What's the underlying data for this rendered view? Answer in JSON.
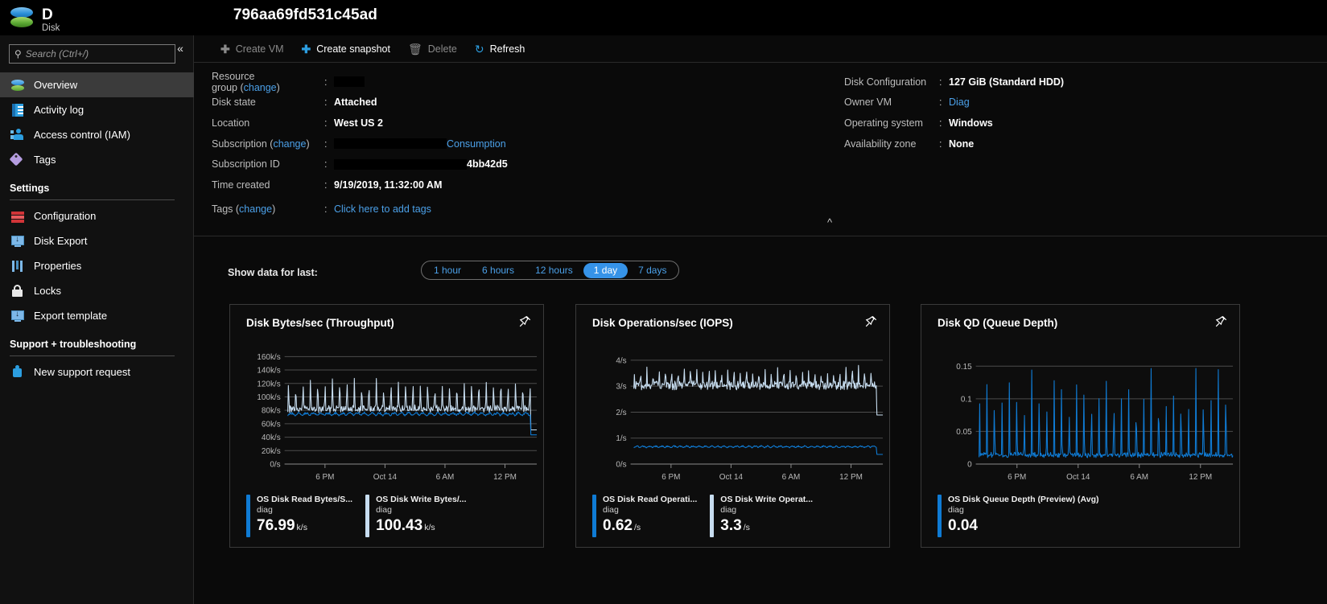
{
  "titlebar": {
    "resource_name": "D",
    "resource_id_suffix": "796aa69fd531c45ad",
    "resource_type": "Disk",
    "icon": "disk-icon"
  },
  "sidebar": {
    "search": {
      "placeholder": "Search (Ctrl+/)",
      "value": "",
      "icon": "search-icon"
    },
    "collapse_icon": "«",
    "items": [
      {
        "label": "Overview",
        "icon": "disk-icon",
        "active": true
      },
      {
        "label": "Activity log",
        "icon": "activity-log-icon",
        "active": false
      },
      {
        "label": "Access control (IAM)",
        "icon": "access-control-icon",
        "active": false
      },
      {
        "label": "Tags",
        "icon": "tag-icon",
        "active": false
      }
    ],
    "settings_header": "Settings",
    "settings_items": [
      {
        "label": "Configuration",
        "icon": "configuration-icon"
      },
      {
        "label": "Disk Export",
        "icon": "disk-export-icon"
      },
      {
        "label": "Properties",
        "icon": "properties-icon"
      },
      {
        "label": "Locks",
        "icon": "lock-icon"
      },
      {
        "label": "Export template",
        "icon": "export-template-icon"
      }
    ],
    "support_header": "Support + troubleshooting",
    "support_items": [
      {
        "label": "New support request",
        "icon": "support-request-icon"
      }
    ]
  },
  "commandbar": {
    "buttons": [
      {
        "label": "Create VM",
        "icon": "plus-icon",
        "enabled": false
      },
      {
        "label": "Create snapshot",
        "icon": "plus-icon",
        "enabled": true
      },
      {
        "label": "Delete",
        "icon": "trash-icon",
        "enabled": false
      },
      {
        "label": "Refresh",
        "icon": "refresh-icon",
        "enabled": true
      }
    ]
  },
  "properties": {
    "left": [
      {
        "label": "Resource group",
        "change_link": "change",
        "value": "",
        "redacted": true,
        "redact_width": 38
      },
      {
        "label": "Disk state",
        "value": "Attached"
      },
      {
        "label": "Location",
        "value": "West US 2"
      },
      {
        "label": "Subscription",
        "change_link": "change",
        "value": "Consumption",
        "redacted": true,
        "redact_width": 140,
        "value_is_link": true
      },
      {
        "label": "Subscription ID",
        "value": "4bb42d5",
        "redacted": true,
        "redact_width": 165
      },
      {
        "label": "Time created",
        "value": "9/19/2019, 11:32:00 AM"
      },
      {
        "label": "Tags",
        "change_link": "change",
        "value": "Click here to add tags",
        "value_is_link": true
      }
    ],
    "right": [
      {
        "label": "Disk Configuration",
        "value": "127 GiB (Standard HDD)"
      },
      {
        "label": "Owner VM",
        "value": "Diag",
        "value_is_link": true
      },
      {
        "label": "Operating system",
        "value": "Windows"
      },
      {
        "label": "Availability zone",
        "value": "None"
      }
    ],
    "collapse_icon": "chevron-up-icon"
  },
  "timerange": {
    "label": "Show data for last:",
    "options": [
      "1 hour",
      "6 hours",
      "12 hours",
      "1 day",
      "7 days"
    ],
    "selected": "1 day"
  },
  "colors": {
    "read_series": "#0f7bd4",
    "write_series": "#c7ddf0",
    "accent": "#3693e8",
    "link": "#4ba0e8"
  },
  "chart_data": [
    {
      "type": "line",
      "title": "Disk Bytes/sec (Throughput)",
      "pin_icon": "pin-icon",
      "xlabel": "",
      "ylabel": "",
      "ytick_labels": [
        "160k/s",
        "140k/s",
        "120k/s",
        "100k/s",
        "80k/s",
        "60k/s",
        "40k/s",
        "20k/s",
        "0/s"
      ],
      "ytick_values": [
        160000,
        140000,
        120000,
        100000,
        80000,
        60000,
        40000,
        20000,
        0
      ],
      "ylim": [
        0,
        170000
      ],
      "xtick_labels": [
        "6 PM",
        "Oct 14",
        "6 AM",
        "12 PM"
      ],
      "grid": true,
      "legend_position": "bottom",
      "series": [
        {
          "name": "OS Disk Read Bytes/S...",
          "resource": "diag",
          "value": "76.99",
          "unit": "k/s",
          "color": "#0f7bd4",
          "baseline": 70000,
          "peak": 80000,
          "spike_count": 34,
          "style": "low-ripple"
        },
        {
          "name": "OS Disk Write Bytes/...",
          "resource": "diag",
          "value": "100.43",
          "unit": "k/s",
          "color": "#c7ddf0",
          "baseline": 82000,
          "peak": 124000,
          "spike_count": 34,
          "style": "sawtooth"
        }
      ]
    },
    {
      "type": "line",
      "title": "Disk Operations/sec (IOPS)",
      "pin_icon": "pin-icon",
      "xlabel": "",
      "ylabel": "",
      "ytick_labels": [
        "4/s",
        "3/s",
        "2/s",
        "1/s",
        "0/s"
      ],
      "ytick_values": [
        4,
        3,
        2,
        1,
        0
      ],
      "ylim": [
        0,
        4.4
      ],
      "xtick_labels": [
        "6 PM",
        "Oct 14",
        "6 AM",
        "12 PM"
      ],
      "grid": true,
      "legend_position": "bottom",
      "series": [
        {
          "name": "OS Disk Read Operati...",
          "resource": "diag",
          "value": "0.62",
          "unit": "/s",
          "color": "#0f7bd4",
          "baseline": 0.6,
          "peak": 0.75,
          "spike_count": 40,
          "style": "low-ripple"
        },
        {
          "name": "OS Disk Write Operat...",
          "resource": "diag",
          "value": "3.3",
          "unit": "/s",
          "color": "#c7ddf0",
          "baseline": 3.05,
          "peak": 3.7,
          "spike_count": 40,
          "style": "sawtooth"
        }
      ]
    },
    {
      "type": "line",
      "title": "Disk QD (Queue Depth)",
      "pin_icon": "pin-icon",
      "xlabel": "",
      "ylabel": "",
      "ytick_labels": [
        "0.15",
        "0.1",
        "0.05",
        "0"
      ],
      "ytick_values": [
        0.15,
        0.1,
        0.05,
        0
      ],
      "ylim": [
        0,
        0.175
      ],
      "xtick_labels": [
        "6 PM",
        "Oct 14",
        "6 AM",
        "12 PM"
      ],
      "grid": true,
      "legend_position": "bottom",
      "series": [
        {
          "name": "OS Disk Queue Depth (Preview) (Avg)",
          "resource": "diag",
          "value": "0.04",
          "unit": "",
          "color": "#0f7bd4",
          "baseline": 0.012,
          "peak": 0.135,
          "spike_count": 34,
          "style": "tall-spikes"
        }
      ]
    }
  ]
}
